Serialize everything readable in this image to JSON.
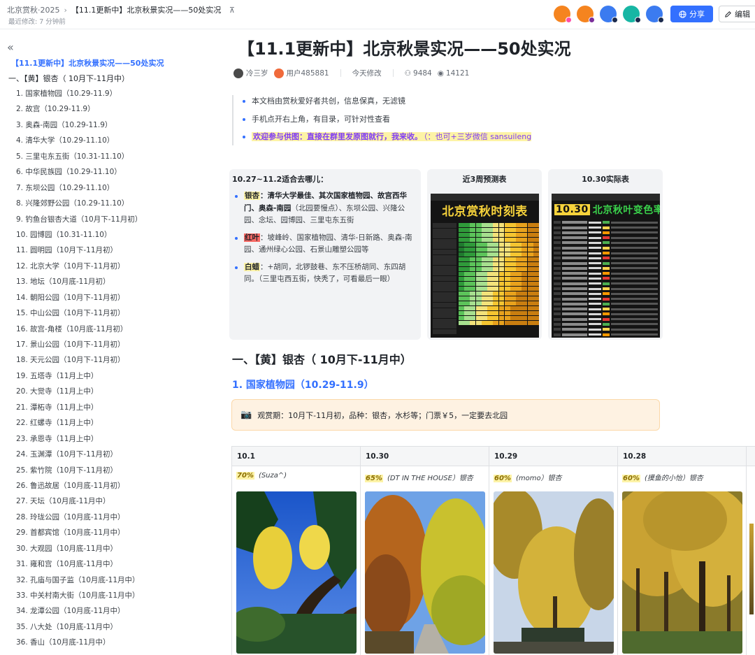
{
  "breadcrumb": {
    "root": "北京赏秋·2025",
    "current": "【11.1更新中】北京秋景实况——50处实况",
    "pin_icon": "pin-icon"
  },
  "last_modified": "最近修改: 7 分钟前",
  "toolbar": {
    "share_label": "分享",
    "edit_label": "编辑"
  },
  "collaborators": [
    {
      "color": "#f5841f",
      "dot": "#ff4da6"
    },
    {
      "color": "#f5841f",
      "dot": "#7a2e9a"
    },
    {
      "color": "#3b7bf0",
      "dot": "#1b2a4d"
    },
    {
      "color": "#17b6a4",
      "dot": "#1b2a4d"
    },
    {
      "color": "#3b7bf0",
      "dot": "#1b2a4d"
    }
  ],
  "sidebar": {
    "heading": "【11.1更新中】北京秋景实况——50处实况",
    "section": "一、【黄】银杏（ 10月下-11月中）",
    "items": [
      "1. 国家植物园（10.29-11.9）",
      "2. 故宫（10.29-11.9）",
      "3. 奥森-南园（10.29-11.9）",
      "4. 清华大学（10.29-11.10）",
      "5. 三里屯东五街（10.31-11.10）",
      "6. 中华民族园（10.29-11.10）",
      "7. 东坝公园（10.29-11.10）",
      "8. 兴隆郊野公园（10.29-11.10）",
      "9. 钓鱼台银杏大道（10月下-11月初）",
      "10. 园博园（10.31-11.10）",
      "11. 圆明园（10月下-11月初）",
      "12. 北京大学（10月下-11月初）",
      "13. 地坛（10月底-11月初）",
      "14. 朝阳公园（10月下-11月初）",
      "15. 中山公园（10月下-11月初）",
      "16. 故宫-角楼（10月底-11月初）",
      "17. 景山公园（10月下-11月初）",
      "18. 天元公园（10月下-11月初）",
      "19. 五塔寺（11月上中）",
      "20. 大觉寺（11月上中）",
      "21. 潭柘寺（11月上中）",
      "22. 红螺寺（11月上中）",
      "23. 承恩寺（11月上中）",
      "24. 玉渊潭（10月下-11月初）",
      "25. 紫竹院（10月下-11月初）",
      "26. 鲁迅故居（10月底-11月初）",
      "27. 天坛（10月底-11月中）",
      "28. 玲珑公园（10月底-11月中）",
      "29. 首都宾馆（10月底-11月中）",
      "30. 大观园（10月底-11月中）",
      "31. 雍和宫（10月底-11月中）",
      "32. 孔庙与国子监（10月底-11月中）",
      "33. 中关村南大街（10月底-11月中）",
      "34. 龙潭公园（10月底-11月中）",
      "35. 八大处（10月底-11月中）",
      "36. 香山（10月底-11月中）"
    ]
  },
  "document": {
    "title": "【11.1更新中】北京秋景实况——50处实况",
    "author1": "冷三岁",
    "author2": "用户485881",
    "modified": "今天修改",
    "views": "9484",
    "reads": "14121",
    "notes": [
      "本文档由赏秋爱好者共创，信息保真，无滤镜",
      "手机点开右上角，有目录，可针对性查看"
    ],
    "note_highlight_bold": "欢迎参与供图：直接在群里发原图就行，我来收。",
    "note_highlight_rest": "（：也可+三岁微信 sansuileng"
  },
  "card_where": {
    "title": "10.27~11.2适合去哪儿：",
    "ginkgo_tag": "银杏",
    "ginkgo_bold": "：清华大学最佳、其次国家植物园、故宫西华门、奥森-南园",
    "ginkgo_rest": "（北园要慢点）、东坝公园、兴隆公园、念坛、园博园、三里屯东五街",
    "redleaf_tag": "红叶",
    "redleaf_text": "：坡峰岭、国家植物园、清华-日新路、奥森-南园、通州绿心公园、石景山雕塑公园等",
    "baila_tag": "白蜡",
    "baila_text": "：+胡同，北锣鼓巷、东不压桥胡同、东四胡同。（三里屯西五街，快秃了，可看最后一眼）"
  },
  "card_forecast": {
    "title": "近3周预测表",
    "poster_heading": "北京赏秋时刻表"
  },
  "card_actual": {
    "title": "10.30实际表",
    "poster_num": "10.30",
    "poster_text": "北京秋叶变色率"
  },
  "section1_heading": "一、【黄】银杏（ 10月下-11月中）",
  "section1_sub": "1. 国家植物园（10.29-11.9）",
  "callout": {
    "icon": "camera-icon",
    "text": "观赏期：10月下-11月初，品种：银杏，水杉等；门票￥5，一定要去北园"
  },
  "photo_table": {
    "columns": [
      {
        "date": "10.1",
        "pct": "70%",
        "credit": "(Suza^)"
      },
      {
        "date": "10.30",
        "pct": "65%",
        "credit": "(DT IN THE HOUSE）银杏"
      },
      {
        "date": "10.29",
        "pct": "60%",
        "credit": "(momo）银杏"
      },
      {
        "date": "10.28",
        "pct": "60%",
        "credit": "(摸鱼的小怡）银杏"
      }
    ]
  }
}
